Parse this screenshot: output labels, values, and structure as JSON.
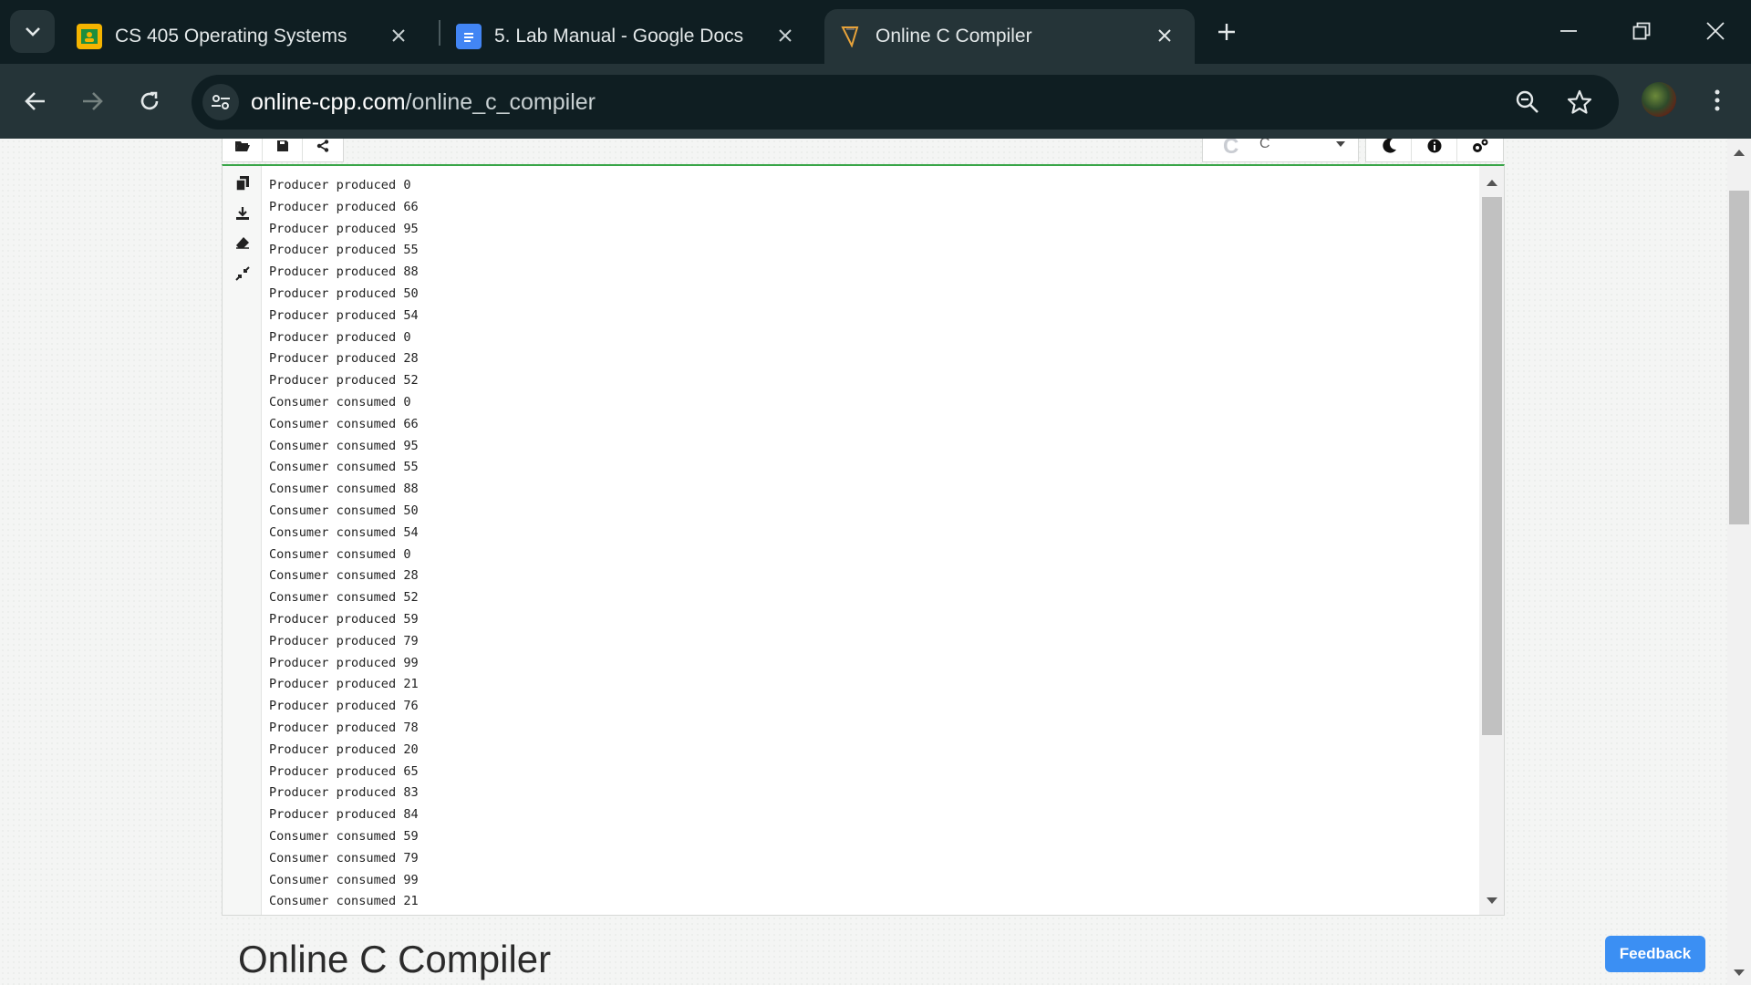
{
  "browser": {
    "tabs": [
      {
        "title": "CS 405 Operating Systems",
        "active": false,
        "icon": "google-classroom-icon"
      },
      {
        "title": "5. Lab Manual - Google Docs",
        "active": false,
        "icon": "google-docs-icon"
      },
      {
        "title": "Online C Compiler",
        "active": true,
        "icon": "online-cpp-icon"
      }
    ],
    "url_host": "online-cpp.com",
    "url_path": "/online_c_compiler"
  },
  "editor": {
    "language": "C"
  },
  "output": {
    "lines": [
      "Producer produced 0",
      "Producer produced 66",
      "Producer produced 95",
      "Producer produced 55",
      "Producer produced 88",
      "Producer produced 50",
      "Producer produced 54",
      "Producer produced 0",
      "Producer produced 28",
      "Producer produced 52",
      "Consumer consumed 0",
      "Consumer consumed 66",
      "Consumer consumed 95",
      "Consumer consumed 55",
      "Consumer consumed 88",
      "Consumer consumed 50",
      "Consumer consumed 54",
      "Consumer consumed 0",
      "Consumer consumed 28",
      "Consumer consumed 52",
      "Producer produced 59",
      "Producer produced 79",
      "Producer produced 99",
      "Producer produced 21",
      "Producer produced 76",
      "Producer produced 78",
      "Producer produced 20",
      "Producer produced 65",
      "Producer produced 83",
      "Producer produced 84",
      "Consumer consumed 59",
      "Consumer consumed 79",
      "Consumer consumed 99",
      "Consumer consumed 21"
    ]
  },
  "page": {
    "heading": "Online C Compiler",
    "feedback_label": "Feedback"
  },
  "colors": {
    "accent_green": "#39a548",
    "feedback_blue": "#3b8ff3",
    "chrome_dark": "#0f1e22"
  }
}
